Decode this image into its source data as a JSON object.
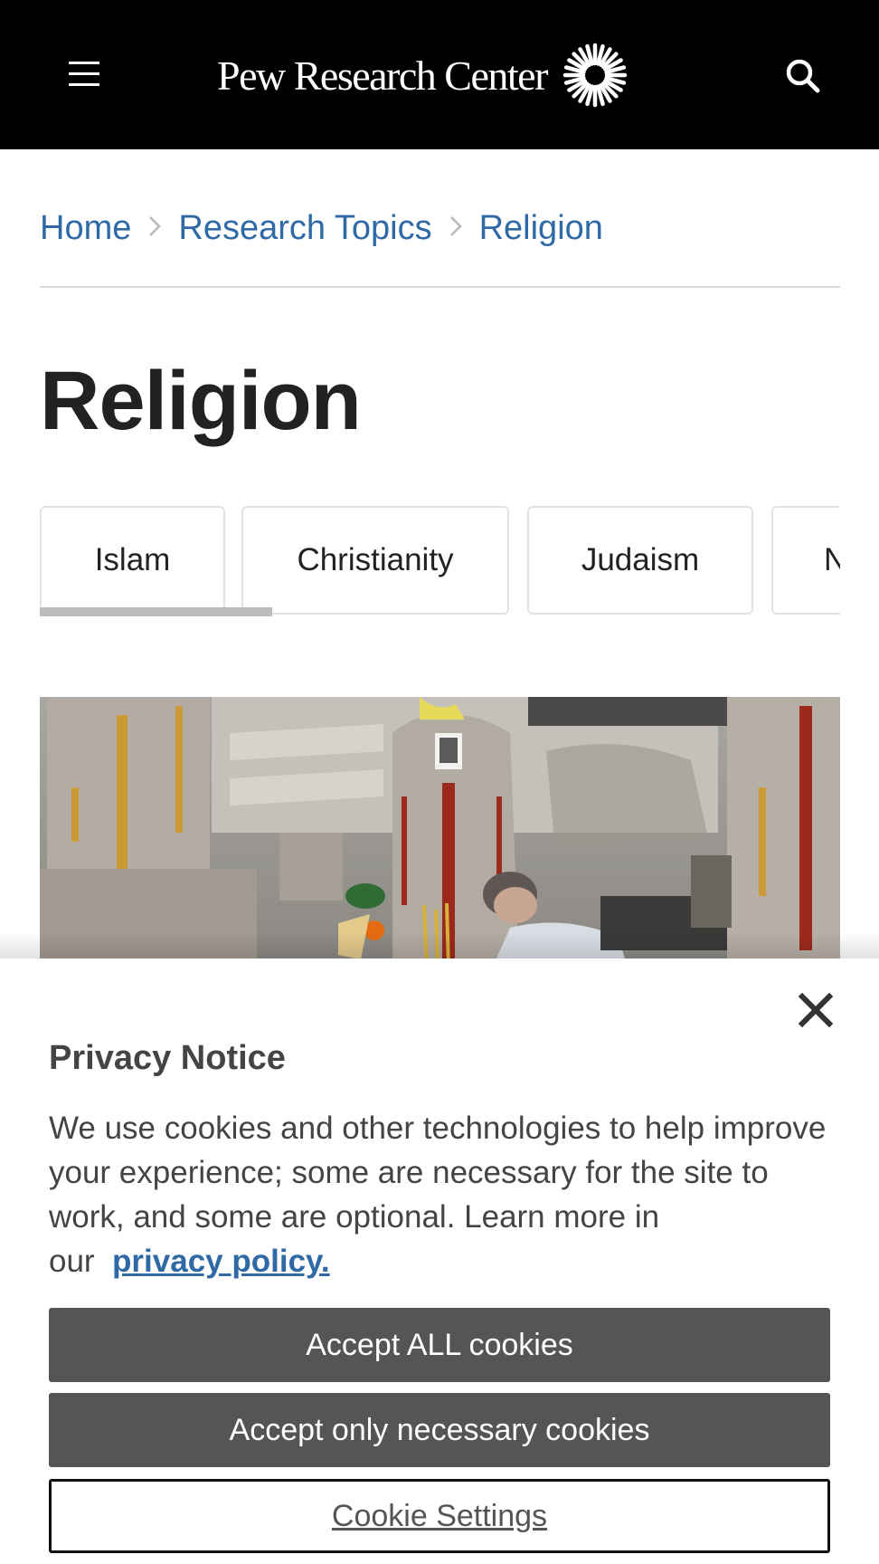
{
  "header": {
    "logo_text": "Pew Research Center",
    "menu_icon": "hamburger-menu-icon",
    "search_icon": "search-icon",
    "background_color": "#000000"
  },
  "breadcrumb": {
    "items": [
      "Home",
      "Research Topics",
      "Religion"
    ],
    "link_color": "#2f6aa6"
  },
  "page": {
    "title": "Religion"
  },
  "tabs": {
    "items": [
      "Islam",
      "Christianity",
      "Judaism",
      "N"
    ],
    "scroll_progress": 0.29
  },
  "hero": {
    "image_alt": "Cemetery with Chinese gravestones and a man tending a grave"
  },
  "cookie_notice": {
    "title": "Privacy Notice",
    "body_text": "We use cookies and other technologies to help improve your experience; some are necessary for the site to work, and some are optional. Learn more in our",
    "policy_link": "privacy policy.",
    "accept_all_label": "Accept ALL cookies",
    "accept_necessary_label": "Accept only necessary cookies",
    "settings_label": "Cookie Settings",
    "close_icon": "close-icon",
    "button_color": "#555555"
  }
}
